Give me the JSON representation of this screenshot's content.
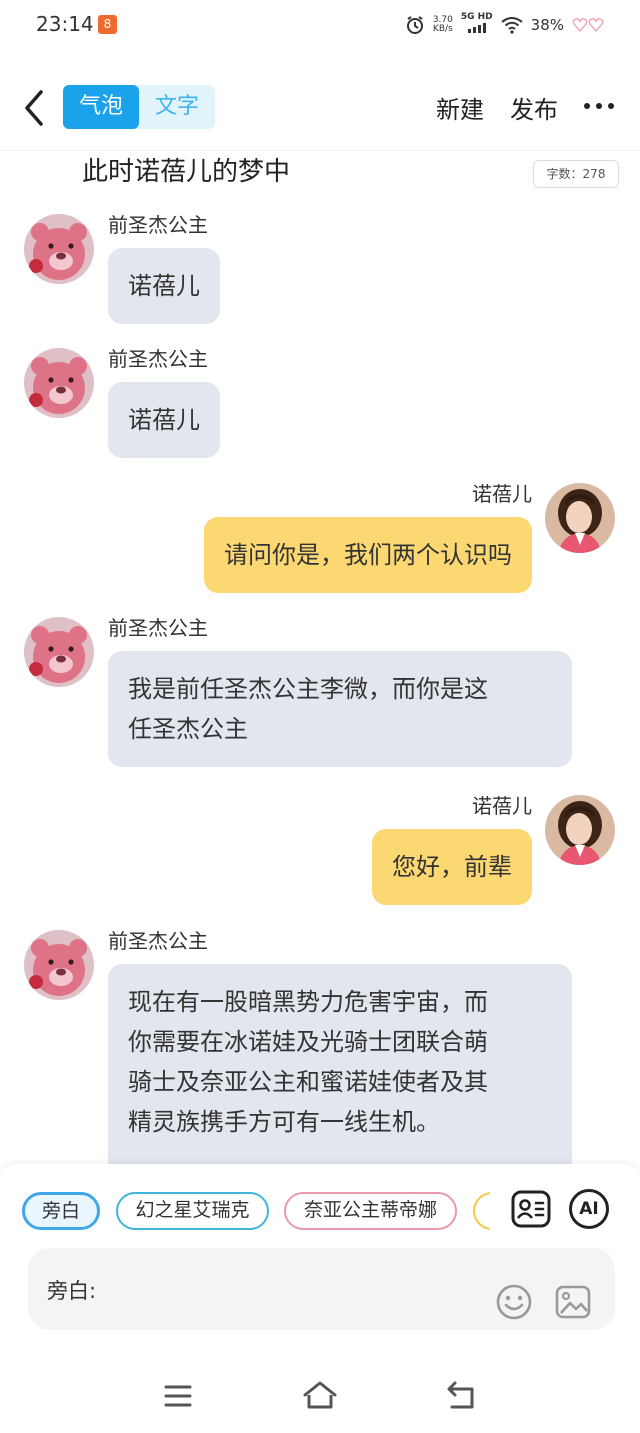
{
  "status_bar": {
    "time": "23:14",
    "app_badge": "8",
    "net_speed_value": "3.70",
    "net_speed_unit": "KB/s",
    "network_type": "5G HD",
    "battery": "38%"
  },
  "header": {
    "tabs": [
      {
        "label": "气泡",
        "active": true
      },
      {
        "label": "文字",
        "active": false
      }
    ],
    "new_label": "新建",
    "publish_label": "发布",
    "accent": "#1aa3ea"
  },
  "scene": {
    "title": "此时诺蓓儿的梦中",
    "word_count": "字数：278"
  },
  "messages": [
    {
      "side": "left",
      "sender": "前圣杰公主",
      "text": "诺蓓儿",
      "avatar": "pink-bear-avatar"
    },
    {
      "side": "left",
      "sender": "前圣杰公主",
      "text": "诺蓓儿",
      "avatar": "pink-bear-avatar"
    },
    {
      "side": "right",
      "sender": "诺蓓儿",
      "text": "请问你是，我们两个认识吗",
      "avatar": "girl-avatar"
    },
    {
      "side": "left",
      "sender": "前圣杰公主",
      "lines": [
        "我是前任圣杰公主李微，而你是这",
        "任圣杰公主"
      ],
      "avatar": "pink-bear-avatar"
    },
    {
      "side": "right",
      "sender": "诺蓓儿",
      "text": "您好，前辈",
      "avatar": "girl-avatar"
    },
    {
      "side": "left",
      "sender": "前圣杰公主",
      "lines": [
        "现在有一股暗黑势力危害宇宙，而",
        "你需要在冰诺娃及光骑士团联合萌",
        "骑士及奈亚公主和蜜诺娃使者及其",
        "精灵族携手方可有一线生机。"
      ],
      "avatar": "pink-bear-avatar"
    }
  ],
  "composer": {
    "roles": [
      "旁白",
      "幻之星艾瑞克",
      "奈亚公主蒂帝娜"
    ],
    "ai_label": "AI",
    "input_label": "旁白:"
  },
  "colors": {
    "left_bubble": "#e2e6ee",
    "right_bubble": "#fcd873"
  }
}
